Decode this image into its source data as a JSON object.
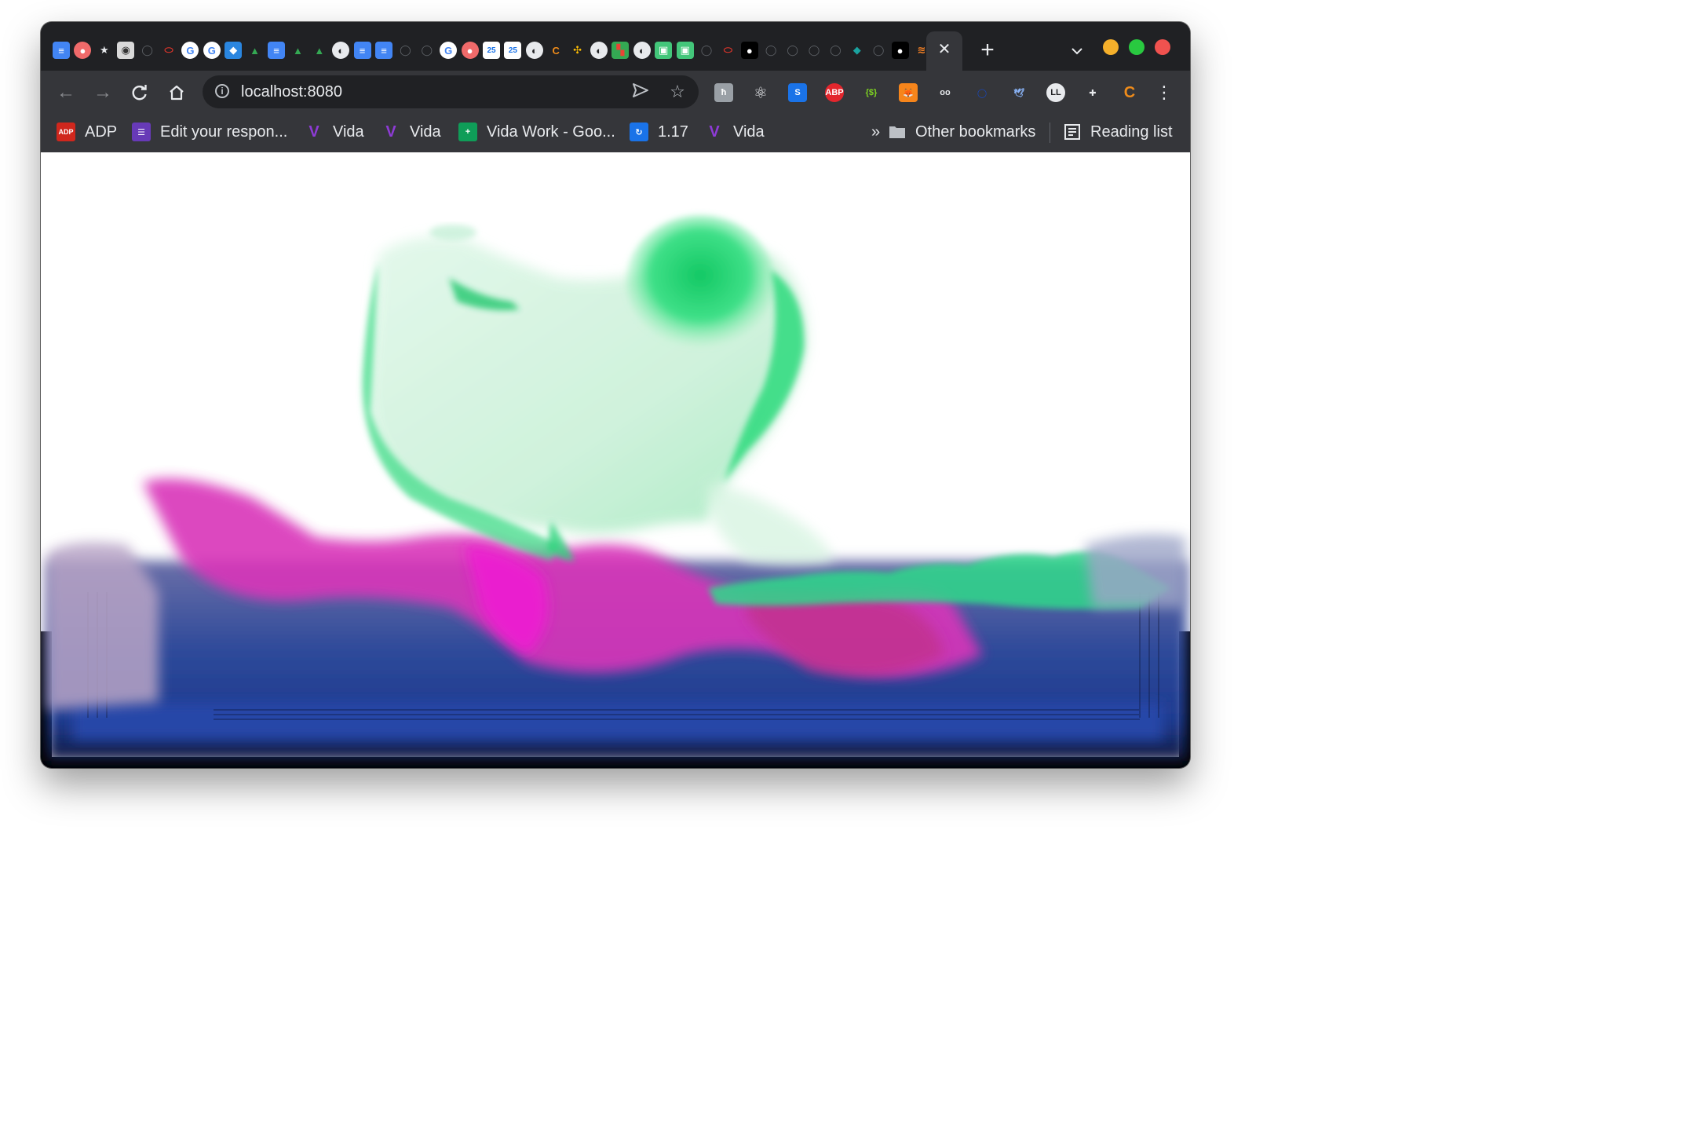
{
  "browser": {
    "colors": {
      "frame": "#202124",
      "toolbar": "#35363a",
      "text": "#e8eaed",
      "traffic_minimize": "#f5b02b",
      "traffic_maximize": "#29c940",
      "traffic_close": "#f0524f"
    },
    "tabs": {
      "favicons": [
        "docs-icon",
        "asana-icon",
        "star-icon",
        "eye-icon",
        "github-icon",
        "oval-icon",
        "google-icon",
        "google-icon",
        "cube-icon",
        "drive-icon",
        "docs-icon",
        "drive-icon",
        "drive-icon",
        "globe-icon",
        "docs-icon",
        "docs-icon",
        "github-icon",
        "github-icon",
        "google-icon",
        "asana-icon",
        "calendar-icon",
        "calendar-icon",
        "globe-icon",
        "c-icon",
        "pinwheel-icon",
        "globe-icon",
        "grid-icon",
        "globe-icon",
        "box-icon",
        "box-icon",
        "github-icon",
        "oval-icon",
        "bear-icon",
        "github-icon",
        "github-icon",
        "github-icon",
        "github-icon",
        "diamond-icon",
        "github-icon",
        "bear-icon",
        "stack-icon"
      ],
      "calendar_day": "25",
      "active_close_icon": "close-icon",
      "new_tab_icon": "plus-icon",
      "tab_search_icon": "chevron-down-icon"
    },
    "toolbar": {
      "back_icon": "back-arrow-icon",
      "forward_icon": "forward-arrow-icon",
      "reload_icon": "reload-icon",
      "home_icon": "home-icon",
      "url": "localhost:8080",
      "site_info_icon": "info-icon",
      "send_icon": "send-icon",
      "bookmark_star_icon": "star-outline-icon",
      "extensions": [
        {
          "icon": "hashnode-icon",
          "label": "ħ"
        },
        {
          "icon": "react-icon",
          "label": "⚛"
        },
        {
          "icon": "s-icon",
          "label": "S"
        },
        {
          "icon": "abp-icon",
          "label": "ABP"
        },
        {
          "icon": "braces-icon",
          "label": "{$}"
        },
        {
          "icon": "metamask-icon",
          "label": ""
        },
        {
          "icon": "owl-icon",
          "label": "oo"
        },
        {
          "icon": "ring-icon",
          "label": ""
        },
        {
          "icon": "bird-icon",
          "label": ""
        },
        {
          "icon": "ll-icon",
          "label": "LL"
        },
        {
          "icon": "puzzle-icon",
          "label": ""
        },
        {
          "icon": "c-icon",
          "label": "C"
        }
      ],
      "menu_icon": "kebab-menu-icon"
    },
    "bookmarks": {
      "items": [
        {
          "icon": "adp-icon",
          "icon_text": "ADP",
          "label": "ADP"
        },
        {
          "icon": "forms-icon",
          "icon_text": "☰",
          "label": "Edit your respon..."
        },
        {
          "icon": "vida-icon",
          "icon_text": "V",
          "label": "Vida"
        },
        {
          "icon": "vida-icon",
          "icon_text": "V",
          "label": "Vida"
        },
        {
          "icon": "sheets-icon",
          "icon_text": "+",
          "label": "Vida Work - Goo..."
        },
        {
          "icon": "app-icon",
          "icon_text": "↻",
          "label": "1.17"
        },
        {
          "icon": "vida-icon",
          "icon_text": "V",
          "label": "Vida"
        }
      ],
      "overflow": "»",
      "other": "Other bookmarks",
      "reading_list": "Reading list"
    }
  },
  "canvas": {
    "description_colors": {
      "green": "#1fd970",
      "magenta": "#e21ec8",
      "blue": "#1f3f9e",
      "navy": "#141d4a"
    }
  }
}
